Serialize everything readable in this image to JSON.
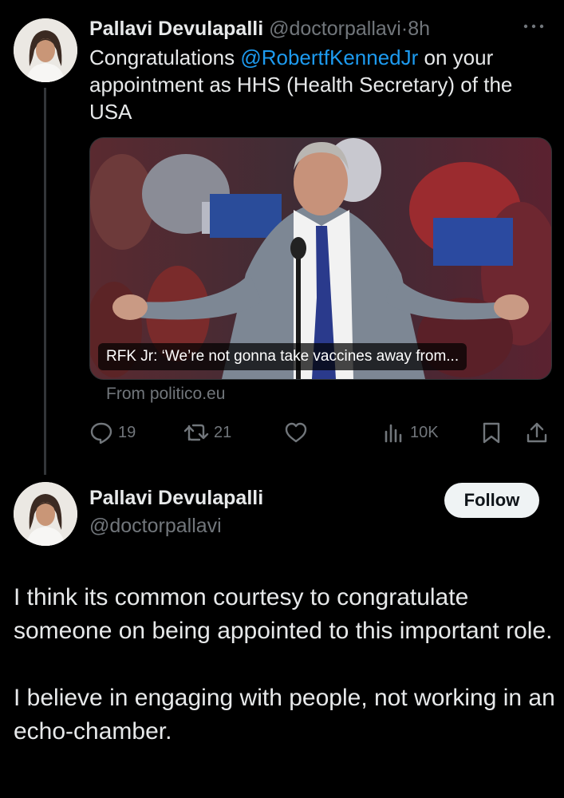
{
  "tweet": {
    "author_name": "Pallavi Devulapalli",
    "author_handle": "@doctorpallavi",
    "separator": "·",
    "time": "8h",
    "text_before": "Congratulations ",
    "mention": "@RobertfKennedJr",
    "text_after": " on your appointment as HHS (Health Secretary) of the USA",
    "card": {
      "caption": "RFK Jr: ‘We’re not gonna take vaccines away from...",
      "source": "From politico.eu"
    },
    "actions": {
      "replies": "19",
      "reposts": "21",
      "views": "10K"
    }
  },
  "reply": {
    "author_name": "Pallavi Devulapalli",
    "author_handle": "@doctorpallavi",
    "follow_label": "Follow",
    "paragraphs": [
      "I think its common courtesy to congratulate someone on being appointed to this important role.",
      "I believe in engaging with people, not working in an echo-chamber."
    ]
  },
  "icons": {
    "more": "more-dots-icon",
    "reply": "reply-bubble-icon",
    "repost": "repost-arrows-icon",
    "like": "heart-icon",
    "views": "views-bars-icon",
    "bookmark": "bookmark-icon",
    "share": "share-upload-icon"
  },
  "colors": {
    "background": "#000000",
    "text": "#e7e9ea",
    "muted": "#71767b",
    "link": "#1d9bf0",
    "follow_bg": "#eff3f4"
  }
}
